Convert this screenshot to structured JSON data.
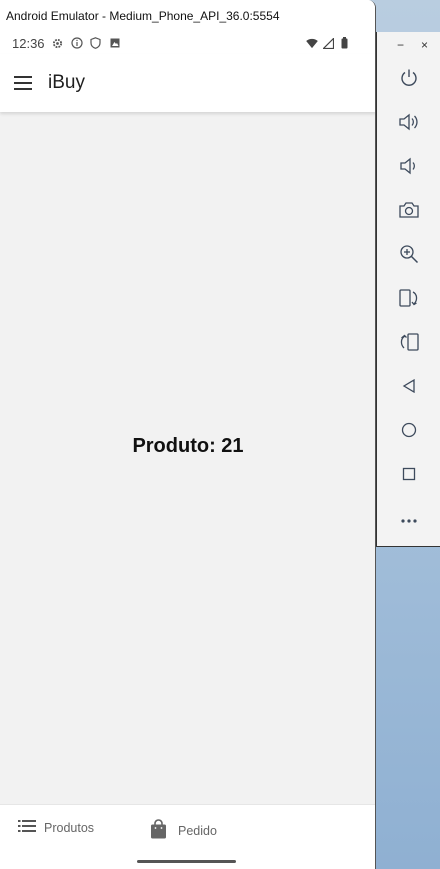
{
  "window": {
    "title": "Android Emulator - Medium_Phone_API_36.0:5554"
  },
  "status_bar": {
    "time": "12:36",
    "left_icons": [
      "gear-icon",
      "info-icon",
      "shield-icon",
      "image-icon"
    ],
    "right_icons": [
      "wifi-icon",
      "cell-signal-icon",
      "battery-icon"
    ]
  },
  "app_bar": {
    "title": "iBuy",
    "menu_icon": "menu-icon"
  },
  "content": {
    "product_label": "Produto: 21"
  },
  "bottom_nav": {
    "items": [
      {
        "label": "Produtos",
        "icon": "list-icon"
      },
      {
        "label": "Pedido",
        "icon": "shopping-bag-icon"
      }
    ]
  },
  "emulator_toolbar": {
    "window_controls": {
      "minimize": "−",
      "close": "×"
    },
    "buttons": [
      "power-icon",
      "volume-up-icon",
      "volume-down-icon",
      "camera-icon",
      "zoom-in-icon",
      "rotate-left-icon",
      "rotate-right-icon",
      "back-icon",
      "home-icon",
      "overview-icon",
      "more-icon"
    ]
  }
}
